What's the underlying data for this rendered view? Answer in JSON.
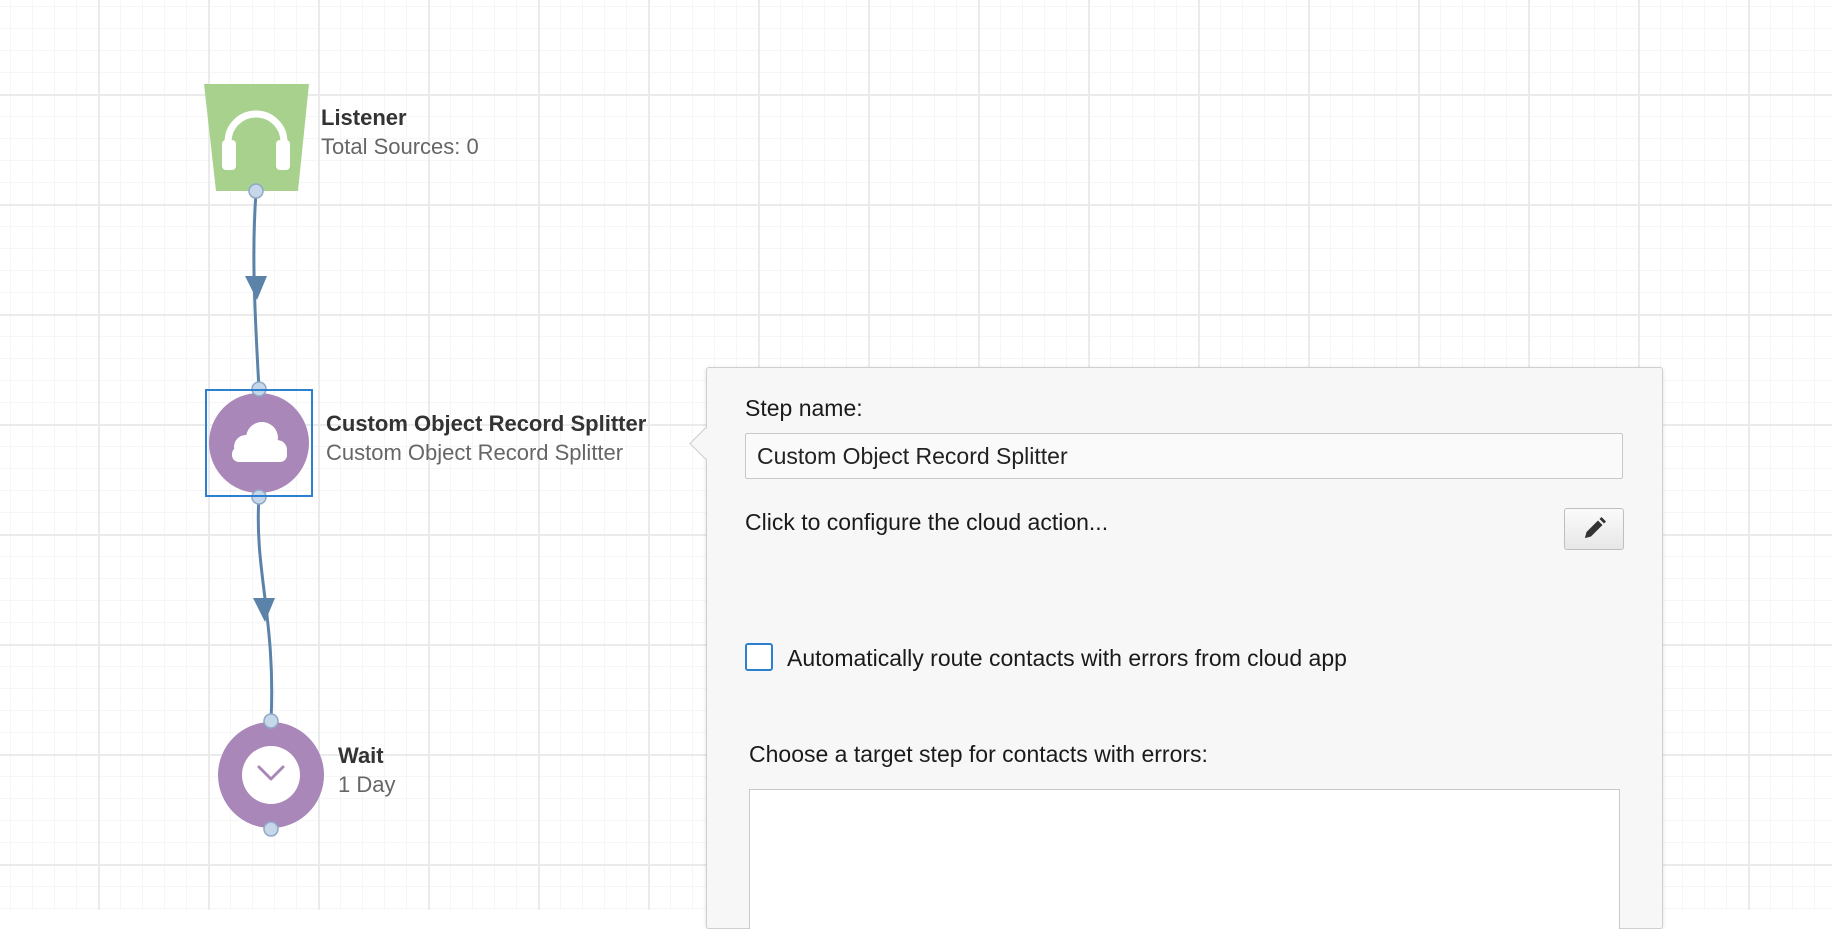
{
  "nodes": {
    "listener": {
      "title": "Listener",
      "subtitle": "Total Sources: 0",
      "icon": "headphones-icon",
      "color": "#a9d18e"
    },
    "splitter": {
      "title": "Custom Object Record Splitter",
      "subtitle": "Custom Object Record Splitter",
      "icon": "cloud-icon",
      "color": "#a987b9"
    },
    "wait": {
      "title": "Wait",
      "subtitle": "1 Day",
      "icon": "clock-icon",
      "color": "#a987b9"
    }
  },
  "panel": {
    "step_name_label": "Step name:",
    "step_name_value": "Custom Object Record Splitter",
    "configure_text": "Click to configure the cloud action...",
    "edit_icon": "pencil-icon",
    "auto_route_label": "Automatically route contacts with errors from cloud app",
    "auto_route_checked": false,
    "target_step_label": "Choose a target step for contacts with errors:"
  },
  "colors": {
    "selection": "#2d7fd0",
    "connector": "#5b83aa",
    "port": "#c6d7ea"
  }
}
